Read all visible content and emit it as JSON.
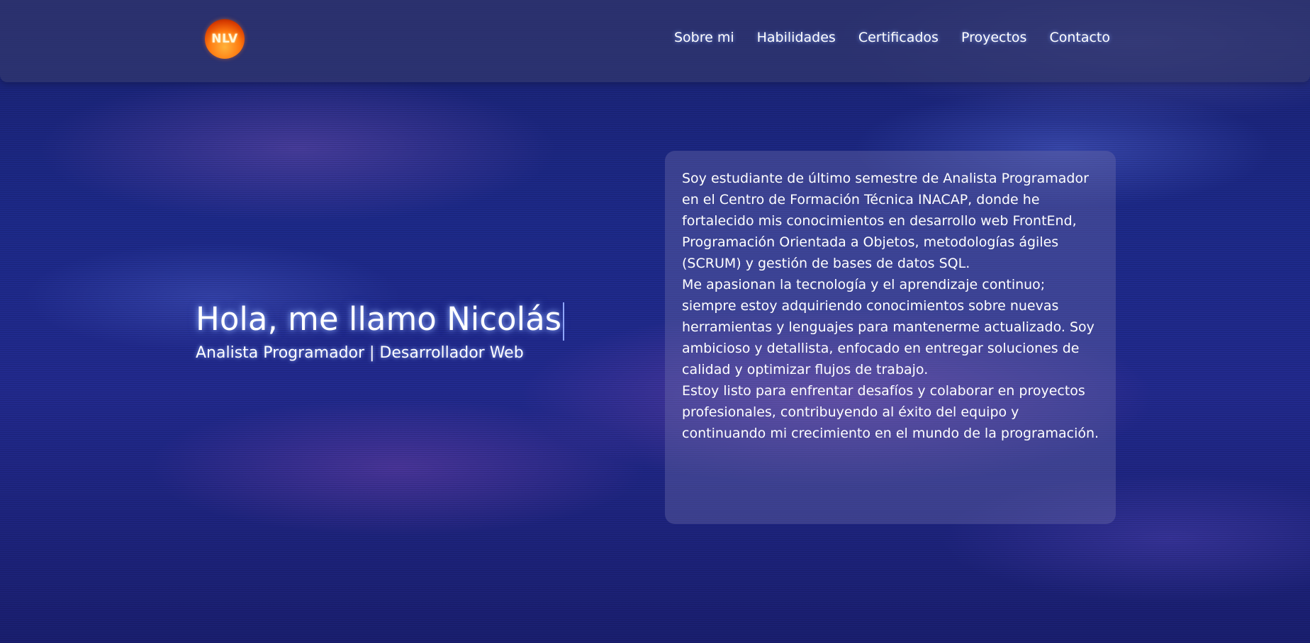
{
  "header": {
    "logo_text": "NLV",
    "nav": [
      {
        "label": "Sobre mi"
      },
      {
        "label": "Habilidades"
      },
      {
        "label": "Certificados"
      },
      {
        "label": "Proyectos"
      },
      {
        "label": "Contacto"
      }
    ]
  },
  "hero": {
    "title": "Hola, me llamo Nicolás",
    "subtitle": "Analista Programador | Desarrollador Web"
  },
  "about": {
    "paragraphs": [
      "Soy estudiante de último semestre de Analista Programador en el Centro de Formación Técnica INACAP, donde he fortalecido mis conocimientos en desarrollo web FrontEnd, Programación Orientada a Objetos, metodologías ágiles (SCRUM) y gestión de bases de datos SQL.",
      "Me apasionan la tecnología y el aprendizaje continuo; siempre estoy adquiriendo conocimientos sobre nuevas herramientas y lenguajes para mantenerme actualizado. Soy ambicioso y detallista, enfocado en entregar soluciones de calidad y optimizar flujos de trabajo.",
      "Estoy listo para enfrentar desafíos y colaborar en proyectos profesionales, contribuyendo al éxito del equipo y continuando mi crecimiento en el mundo de la programación."
    ]
  },
  "colors": {
    "background": "#1d2a8a",
    "nav_bar": "#32386e",
    "logo_orange": "#ff7a10",
    "text": "#ffffff",
    "cursor": "#8fa6ff"
  }
}
